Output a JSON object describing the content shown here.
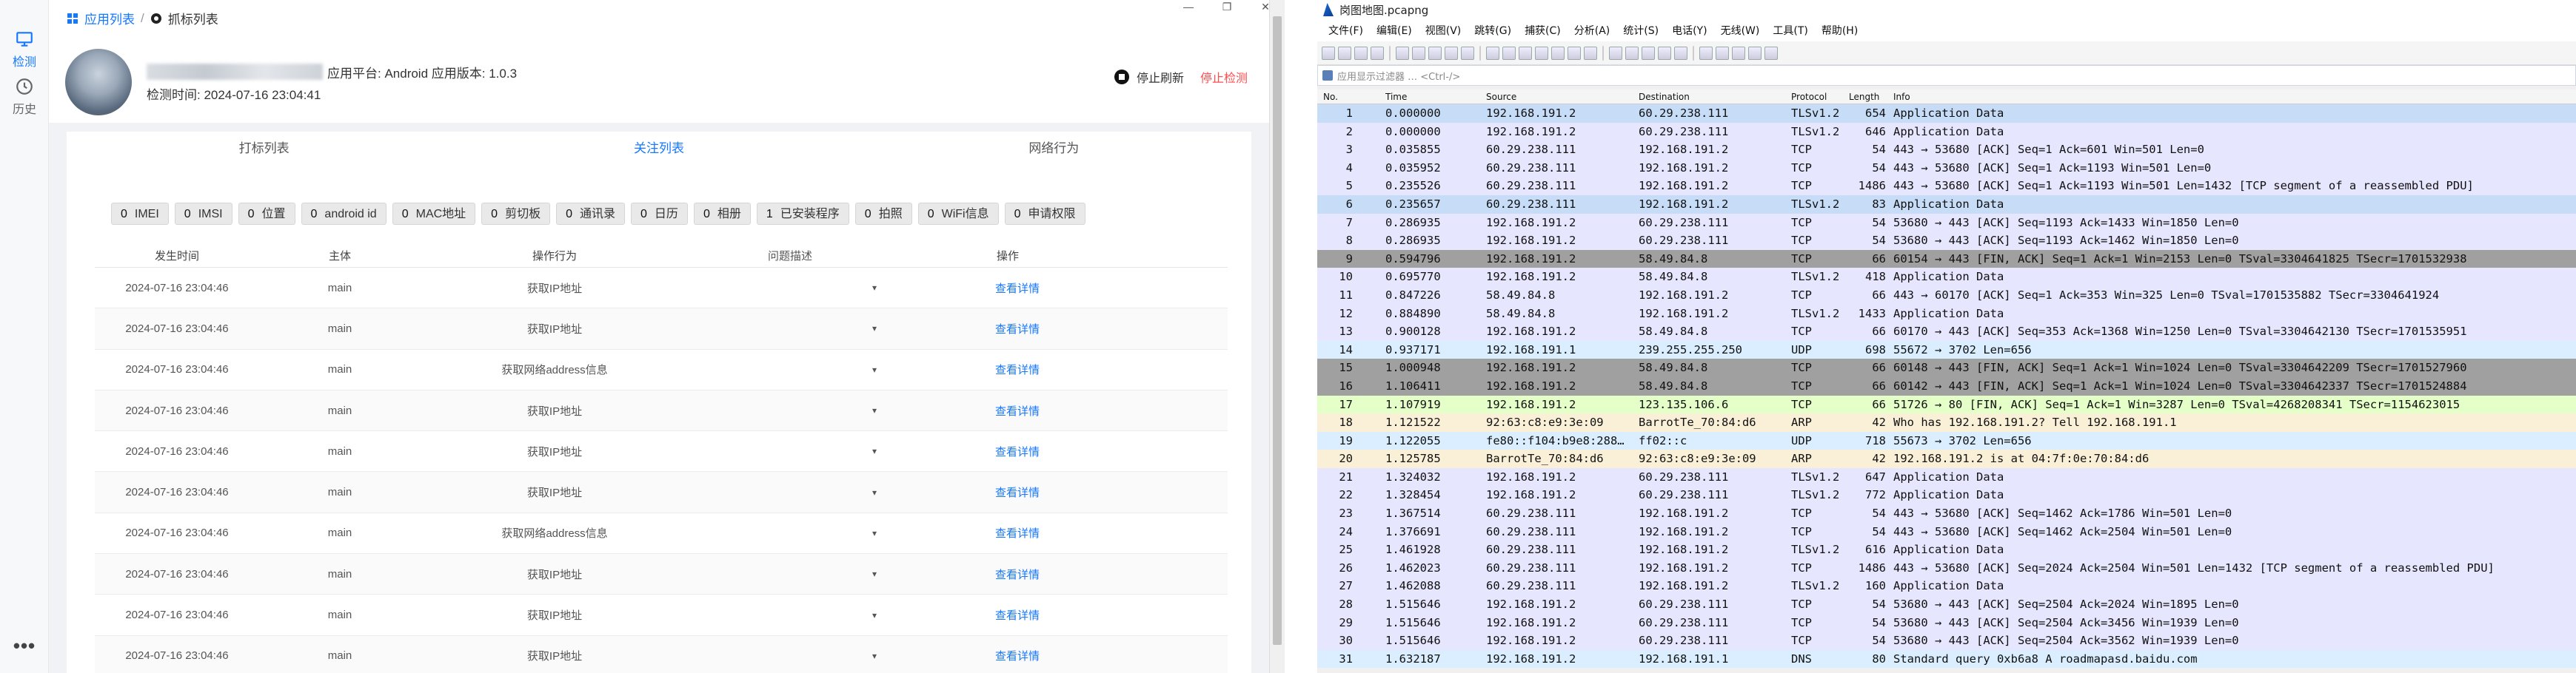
{
  "left": {
    "rail": {
      "detect": "检测",
      "history": "历史",
      "more": "•••"
    },
    "breadcrumb": {
      "apps": "应用列表",
      "sep": "/",
      "current": "抓标列表"
    },
    "window_controls": [
      "—",
      "❐",
      "✕"
    ],
    "app": {
      "platform": "应用平台: Android 应用版本: 1.0.3",
      "check_time": "检测时间: 2024-07-16 23:04:41",
      "stop_refresh": "停止刷新",
      "stop_detect": "停止检测"
    },
    "tabs": [
      "打标列表",
      "关注列表",
      "网络行为"
    ],
    "active_tab": 1,
    "tags": [
      {
        "count": "0",
        "label": "IMEI"
      },
      {
        "count": "0",
        "label": "IMSI"
      },
      {
        "count": "0",
        "label": "位置"
      },
      {
        "count": "0",
        "label": "android id"
      },
      {
        "count": "0",
        "label": "MAC地址"
      },
      {
        "count": "0",
        "label": "剪切板"
      },
      {
        "count": "0",
        "label": "通讯录"
      },
      {
        "count": "0",
        "label": "日历"
      },
      {
        "count": "0",
        "label": "相册"
      },
      {
        "count": "1",
        "label": "已安装程序"
      },
      {
        "count": "0",
        "label": "拍照"
      },
      {
        "count": "0",
        "label": "WiFi信息"
      },
      {
        "count": "0",
        "label": "申请权限"
      }
    ],
    "table": {
      "headers": [
        "发生时间",
        "主体",
        "操作行为",
        "问题描述",
        "操作"
      ],
      "rows": [
        [
          "2024-07-16 23:04:46",
          "main",
          "获取IP地址",
          "▾",
          "查看详情"
        ],
        [
          "2024-07-16 23:04:46",
          "main",
          "获取IP地址",
          "▾",
          "查看详情"
        ],
        [
          "2024-07-16 23:04:46",
          "main",
          "获取网络address信息",
          "▾",
          "查看详情"
        ],
        [
          "2024-07-16 23:04:46",
          "main",
          "获取IP地址",
          "▾",
          "查看详情"
        ],
        [
          "2024-07-16 23:04:46",
          "main",
          "获取IP地址",
          "▾",
          "查看详情"
        ],
        [
          "2024-07-16 23:04:46",
          "main",
          "获取IP地址",
          "▾",
          "查看详情"
        ],
        [
          "2024-07-16 23:04:46",
          "main",
          "获取网络address信息",
          "▾",
          "查看详情"
        ],
        [
          "2024-07-16 23:04:46",
          "main",
          "获取IP地址",
          "▾",
          "查看详情"
        ],
        [
          "2024-07-16 23:04:46",
          "main",
          "获取IP地址",
          "▾",
          "查看详情"
        ],
        [
          "2024-07-16 23:04:46",
          "main",
          "获取IP地址",
          "▾",
          "查看详情"
        ]
      ]
    }
  },
  "wireshark": {
    "title": "岗图地图.pcapng",
    "menu": [
      "文件(F)",
      "编辑(E)",
      "视图(V)",
      "跳转(G)",
      "捕获(C)",
      "分析(A)",
      "统计(S)",
      "电话(Y)",
      "无线(W)",
      "工具(T)",
      "帮助(H)"
    ],
    "filter_placeholder": "应用显示过滤器 … <Ctrl-/>",
    "columns": [
      "No.",
      "Time",
      "Source",
      "Destination",
      "Protocol",
      "Length",
      "Info"
    ],
    "colors": {
      "tcp": "#e7e6ff",
      "tls": "#e7e6ff",
      "fin": "#a0a0a0",
      "udp": "#daeeff",
      "arp": "#faf0d7",
      "selected_http": "#e4ffc7",
      "dns": "#daeeff",
      "sel": "#c6dcf7"
    },
    "packets": [
      {
        "no": "1",
        "time": "0.000000",
        "src": "192.168.191.2",
        "dst": "60.29.238.111",
        "proto": "TLSv1.2",
        "len": "654",
        "info": "Application Data",
        "color": "sel"
      },
      {
        "no": "2",
        "time": "0.000000",
        "src": "192.168.191.2",
        "dst": "60.29.238.111",
        "proto": "TLSv1.2",
        "len": "646",
        "info": "Application Data",
        "color": "tls"
      },
      {
        "no": "3",
        "time": "0.035855",
        "src": "60.29.238.111",
        "dst": "192.168.191.2",
        "proto": "TCP",
        "len": "54",
        "info": "443 → 53680 [ACK] Seq=1 Ack=601 Win=501 Len=0",
        "color": "tcp"
      },
      {
        "no": "4",
        "time": "0.035952",
        "src": "60.29.238.111",
        "dst": "192.168.191.2",
        "proto": "TCP",
        "len": "54",
        "info": "443 → 53680 [ACK] Seq=1 Ack=1193 Win=501 Len=0",
        "color": "tcp"
      },
      {
        "no": "5",
        "time": "0.235526",
        "src": "60.29.238.111",
        "dst": "192.168.191.2",
        "proto": "TCP",
        "len": "1486",
        "info": "443 → 53680 [ACK] Seq=1 Ack=1193 Win=501 Len=1432 [TCP segment of a reassembled PDU]",
        "color": "tcp"
      },
      {
        "no": "6",
        "time": "0.235657",
        "src": "60.29.238.111",
        "dst": "192.168.191.2",
        "proto": "TLSv1.2",
        "len": "83",
        "info": "Application Data",
        "color": "sel"
      },
      {
        "no": "7",
        "time": "0.286935",
        "src": "192.168.191.2",
        "dst": "60.29.238.111",
        "proto": "TCP",
        "len": "54",
        "info": "53680 → 443 [ACK] Seq=1193 Ack=1433 Win=1850 Len=0",
        "color": "tcp"
      },
      {
        "no": "8",
        "time": "0.286935",
        "src": "192.168.191.2",
        "dst": "60.29.238.111",
        "proto": "TCP",
        "len": "54",
        "info": "53680 → 443 [ACK] Seq=1193 Ack=1462 Win=1850 Len=0",
        "color": "tcp"
      },
      {
        "no": "9",
        "time": "0.594796",
        "src": "192.168.191.2",
        "dst": "58.49.84.8",
        "proto": "TCP",
        "len": "66",
        "info": "60154 → 443 [FIN, ACK] Seq=1 Ack=1 Win=2153 Len=0 TSval=3304641825 TSecr=1701532938",
        "color": "fin"
      },
      {
        "no": "10",
        "time": "0.695770",
        "src": "192.168.191.2",
        "dst": "58.49.84.8",
        "proto": "TLSv1.2",
        "len": "418",
        "info": "Application Data",
        "color": "tls"
      },
      {
        "no": "11",
        "time": "0.847226",
        "src": "58.49.84.8",
        "dst": "192.168.191.2",
        "proto": "TCP",
        "len": "66",
        "info": "443 → 60170 [ACK] Seq=1 Ack=353 Win=325 Len=0 TSval=1701535882 TSecr=3304641924",
        "color": "tcp"
      },
      {
        "no": "12",
        "time": "0.884890",
        "src": "58.49.84.8",
        "dst": "192.168.191.2",
        "proto": "TLSv1.2",
        "len": "1433",
        "info": "Application Data",
        "color": "tls"
      },
      {
        "no": "13",
        "time": "0.900128",
        "src": "192.168.191.2",
        "dst": "58.49.84.8",
        "proto": "TCP",
        "len": "66",
        "info": "60170 → 443 [ACK] Seq=353 Ack=1368 Win=1250 Len=0 TSval=3304642130 TSecr=1701535951",
        "color": "tcp"
      },
      {
        "no": "14",
        "time": "0.937171",
        "src": "192.168.191.1",
        "dst": "239.255.255.250",
        "proto": "UDP",
        "len": "698",
        "info": "55672 → 3702 Len=656",
        "color": "udp"
      },
      {
        "no": "15",
        "time": "1.000948",
        "src": "192.168.191.2",
        "dst": "58.49.84.8",
        "proto": "TCP",
        "len": "66",
        "info": "60148 → 443 [FIN, ACK] Seq=1 Ack=1 Win=1024 Len=0 TSval=3304642209 TSecr=1701527960",
        "color": "fin"
      },
      {
        "no": "16",
        "time": "1.106411",
        "src": "192.168.191.2",
        "dst": "58.49.84.8",
        "proto": "TCP",
        "len": "66",
        "info": "60142 → 443 [FIN, ACK] Seq=1 Ack=1 Win=1024 Len=0 TSval=3304642337 TSecr=1701524884",
        "color": "fin"
      },
      {
        "no": "17",
        "time": "1.107919",
        "src": "192.168.191.2",
        "dst": "123.135.106.6",
        "proto": "TCP",
        "len": "66",
        "info": "51726 → 80 [FIN, ACK] Seq=1 Ack=1 Win=3287 Len=0 TSval=4268208341 TSecr=1154623015",
        "color": "selected_http"
      },
      {
        "no": "18",
        "time": "1.121522",
        "src": "92:63:c8:e9:3e:09",
        "dst": "BarrotTe_70:84:d6",
        "proto": "ARP",
        "len": "42",
        "info": "Who has 192.168.191.2? Tell 192.168.191.1",
        "color": "arp"
      },
      {
        "no": "19",
        "time": "1.122055",
        "src": "fe80::f104:b9e8:288…",
        "dst": "ff02::c",
        "proto": "UDP",
        "len": "718",
        "info": "55673 → 3702 Len=656",
        "color": "udp"
      },
      {
        "no": "20",
        "time": "1.125785",
        "src": "BarrotTe_70:84:d6",
        "dst": "92:63:c8:e9:3e:09",
        "proto": "ARP",
        "len": "42",
        "info": "192.168.191.2 is at 04:7f:0e:70:84:d6",
        "color": "arp"
      },
      {
        "no": "21",
        "time": "1.324032",
        "src": "192.168.191.2",
        "dst": "60.29.238.111",
        "proto": "TLSv1.2",
        "len": "647",
        "info": "Application Data",
        "color": "tls"
      },
      {
        "no": "22",
        "time": "1.328454",
        "src": "192.168.191.2",
        "dst": "60.29.238.111",
        "proto": "TLSv1.2",
        "len": "772",
        "info": "Application Data",
        "color": "tls"
      },
      {
        "no": "23",
        "time": "1.367514",
        "src": "60.29.238.111",
        "dst": "192.168.191.2",
        "proto": "TCP",
        "len": "54",
        "info": "443 → 53680 [ACK] Seq=1462 Ack=1786 Win=501 Len=0",
        "color": "tcp"
      },
      {
        "no": "24",
        "time": "1.376691",
        "src": "60.29.238.111",
        "dst": "192.168.191.2",
        "proto": "TCP",
        "len": "54",
        "info": "443 → 53680 [ACK] Seq=1462 Ack=2504 Win=501 Len=0",
        "color": "tcp"
      },
      {
        "no": "25",
        "time": "1.461928",
        "src": "60.29.238.111",
        "dst": "192.168.191.2",
        "proto": "TLSv1.2",
        "len": "616",
        "info": "Application Data",
        "color": "tls"
      },
      {
        "no": "26",
        "time": "1.462023",
        "src": "60.29.238.111",
        "dst": "192.168.191.2",
        "proto": "TCP",
        "len": "1486",
        "info": "443 → 53680 [ACK] Seq=2024 Ack=2504 Win=501 Len=1432 [TCP segment of a reassembled PDU]",
        "color": "tcp"
      },
      {
        "no": "27",
        "time": "1.462088",
        "src": "60.29.238.111",
        "dst": "192.168.191.2",
        "proto": "TLSv1.2",
        "len": "160",
        "info": "Application Data",
        "color": "tls"
      },
      {
        "no": "28",
        "time": "1.515646",
        "src": "192.168.191.2",
        "dst": "60.29.238.111",
        "proto": "TCP",
        "len": "54",
        "info": "53680 → 443 [ACK] Seq=2504 Ack=2024 Win=1895 Len=0",
        "color": "tcp"
      },
      {
        "no": "29",
        "time": "1.515646",
        "src": "192.168.191.2",
        "dst": "60.29.238.111",
        "proto": "TCP",
        "len": "54",
        "info": "53680 → 443 [ACK] Seq=2504 Ack=3456 Win=1939 Len=0",
        "color": "tcp"
      },
      {
        "no": "30",
        "time": "1.515646",
        "src": "192.168.191.2",
        "dst": "60.29.238.111",
        "proto": "TCP",
        "len": "54",
        "info": "53680 → 443 [ACK] Seq=2504 Ack=3562 Win=1939 Len=0",
        "color": "tcp"
      },
      {
        "no": "31",
        "time": "1.632187",
        "src": "192.168.191.2",
        "dst": "192.168.191.1",
        "proto": "DNS",
        "len": "80",
        "info": "Standard query 0xb6a8 A roadmapasd.baidu.com",
        "color": "dns"
      }
    ]
  }
}
